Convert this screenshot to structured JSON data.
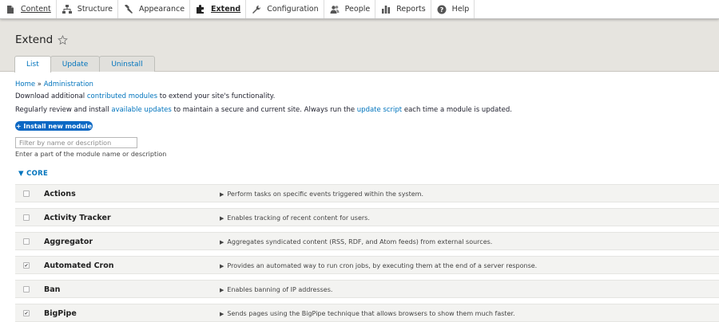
{
  "toolbar": {
    "items": [
      {
        "label": "Content",
        "icon": "content-icon"
      },
      {
        "label": "Structure",
        "icon": "structure-icon"
      },
      {
        "label": "Appearance",
        "icon": "appearance-icon"
      },
      {
        "label": "Extend",
        "icon": "extend-icon"
      },
      {
        "label": "Configuration",
        "icon": "configuration-icon"
      },
      {
        "label": "People",
        "icon": "people-icon"
      },
      {
        "label": "Reports",
        "icon": "reports-icon"
      },
      {
        "label": "Help",
        "icon": "help-icon"
      }
    ]
  },
  "page": {
    "title": "Extend",
    "tabs": [
      "List",
      "Update",
      "Uninstall"
    ]
  },
  "breadcrumb": {
    "home": "Home",
    "sep": " » ",
    "admin": "Administration"
  },
  "intro": {
    "l1_pre": "Download additional ",
    "l1_link": "contributed modules",
    "l1_post": " to extend your site's functionality.",
    "l2_pre": "Regularly review and install ",
    "l2_link1": "available updates",
    "l2_mid": " to maintain a secure and current site. Always run the ",
    "l2_link2": "update script",
    "l2_post": " each time a module is updated."
  },
  "install_button": "+ Install new module",
  "filter": {
    "placeholder": "Filter by name or description",
    "description": "Enter a part of the module name or description"
  },
  "section": {
    "label": "▼ CORE"
  },
  "modules": [
    {
      "name": "Actions",
      "desc": "Perform tasks on specific events triggered within the system.",
      "checked": false
    },
    {
      "name": "Activity Tracker",
      "desc": "Enables tracking of recent content for users.",
      "checked": false
    },
    {
      "name": "Aggregator",
      "desc": "Aggregates syndicated content (RSS, RDF, and Atom feeds) from external sources.",
      "checked": false
    },
    {
      "name": "Automated Cron",
      "desc": "Provides an automated way to run cron jobs, by executing them at the end of a server response.",
      "checked": true
    },
    {
      "name": "Ban",
      "desc": "Enables banning of IP addresses.",
      "checked": false
    },
    {
      "name": "BigPipe",
      "desc": "Sends pages using the BigPipe technique that allows browsers to show them much faster.",
      "checked": true
    }
  ]
}
